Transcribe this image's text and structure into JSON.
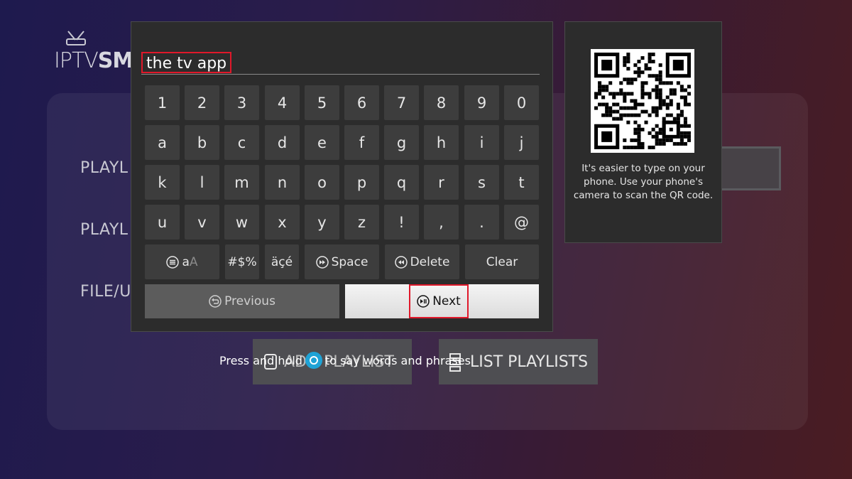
{
  "background": {
    "logo_text_light": "IPTV",
    "logo_text_bold": "SMA",
    "labels": [
      "PLAYL",
      "PLAYL",
      "FILE/U"
    ],
    "add_playlist_label": "ADD PLAYLIST",
    "list_playlists_label": "LIST PLAYLISTS"
  },
  "input": {
    "value": "the tv app"
  },
  "keyboard": {
    "rows": [
      [
        "1",
        "2",
        "3",
        "4",
        "5",
        "6",
        "7",
        "8",
        "9",
        "0"
      ],
      [
        "a",
        "b",
        "c",
        "d",
        "e",
        "f",
        "g",
        "h",
        "i",
        "j"
      ],
      [
        "k",
        "l",
        "m",
        "n",
        "o",
        "p",
        "q",
        "r",
        "s",
        "t"
      ],
      [
        "u",
        "v",
        "w",
        "x",
        "y",
        "z",
        "!",
        ",",
        ".",
        "@"
      ]
    ],
    "case_label_main": "a",
    "case_label_dim": "A",
    "symbols_label": "#$%",
    "accents_label": "äçé",
    "space_label": "Space",
    "delete_label": "Delete",
    "clear_label": "Clear",
    "previous_label": "Previous",
    "next_label": "Next"
  },
  "qr": {
    "hint": "It's easier to type on your phone. Use your phone's camera to scan the QR code."
  },
  "voice_hint": {
    "before": "Press and hold",
    "after": "to say words and phrases"
  },
  "colors": {
    "highlight": "#e0182a",
    "alexa": "#1fa3d6",
    "key": "#3d3d3d",
    "panel": "#2c2c2c"
  }
}
